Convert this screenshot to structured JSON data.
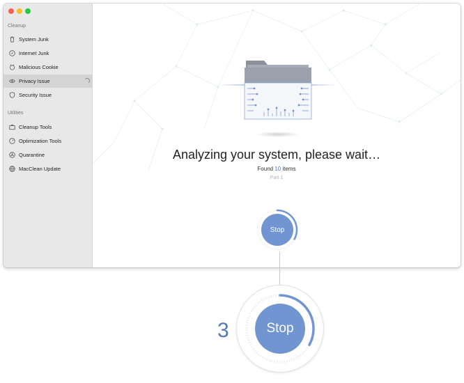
{
  "sidebar": {
    "sections": [
      {
        "label": "Cleanup",
        "items": [
          {
            "label": "System Junk",
            "icon": "trash-icon",
            "active": false
          },
          {
            "label": "Internet Junk",
            "icon": "compass-icon",
            "active": false
          },
          {
            "label": "Malicious Cookie",
            "icon": "cookie-icon",
            "active": false
          },
          {
            "label": "Privacy Issue",
            "icon": "eye-icon",
            "active": true
          },
          {
            "label": "Security Issue",
            "icon": "shield-icon",
            "active": false
          }
        ]
      },
      {
        "label": "Utilities",
        "items": [
          {
            "label": "Cleanup Tools",
            "icon": "briefcase-icon",
            "active": false
          },
          {
            "label": "Optimization Tools",
            "icon": "gauge-icon",
            "active": false
          },
          {
            "label": "Quarantine",
            "icon": "biohazard-icon",
            "active": false
          },
          {
            "label": "MacClean Update",
            "icon": "globe-icon",
            "active": false
          }
        ]
      }
    ]
  },
  "main": {
    "title": "Analyzing your system, please wait…",
    "found_prefix": "Found",
    "found_count": "10",
    "found_suffix": "items",
    "part": "Part 1",
    "stop_label": "Stop",
    "progress_fraction": 0.33
  },
  "callout": {
    "step_number": "3",
    "stop_label": "Stop"
  },
  "colors": {
    "accent": "#7195d1",
    "count": "#4a7fd4",
    "step": "#5379b8",
    "sidebar_bg": "#e8e8e8",
    "active_item": "#d4d4d4"
  }
}
